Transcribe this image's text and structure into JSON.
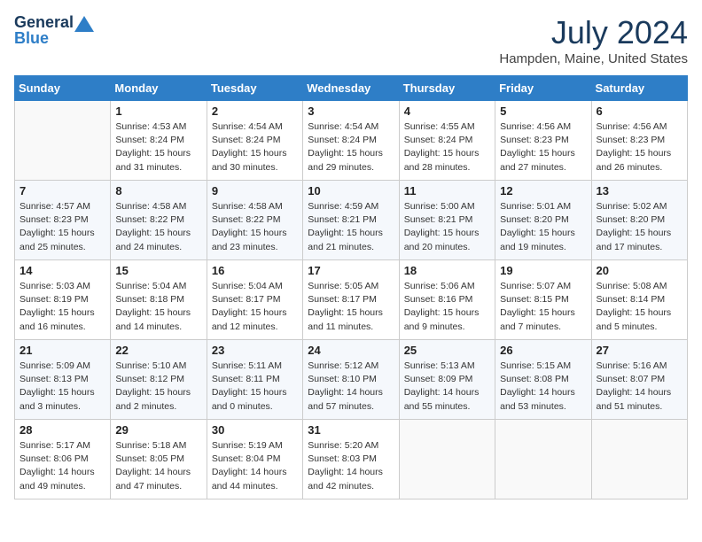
{
  "header": {
    "logo_line1": "General",
    "logo_line2": "Blue",
    "title": "July 2024",
    "subtitle": "Hampden, Maine, United States"
  },
  "weekdays": [
    "Sunday",
    "Monday",
    "Tuesday",
    "Wednesday",
    "Thursday",
    "Friday",
    "Saturday"
  ],
  "weeks": [
    [
      {
        "day": "",
        "info": ""
      },
      {
        "day": "1",
        "info": "Sunrise: 4:53 AM\nSunset: 8:24 PM\nDaylight: 15 hours\nand 31 minutes."
      },
      {
        "day": "2",
        "info": "Sunrise: 4:54 AM\nSunset: 8:24 PM\nDaylight: 15 hours\nand 30 minutes."
      },
      {
        "day": "3",
        "info": "Sunrise: 4:54 AM\nSunset: 8:24 PM\nDaylight: 15 hours\nand 29 minutes."
      },
      {
        "day": "4",
        "info": "Sunrise: 4:55 AM\nSunset: 8:24 PM\nDaylight: 15 hours\nand 28 minutes."
      },
      {
        "day": "5",
        "info": "Sunrise: 4:56 AM\nSunset: 8:23 PM\nDaylight: 15 hours\nand 27 minutes."
      },
      {
        "day": "6",
        "info": "Sunrise: 4:56 AM\nSunset: 8:23 PM\nDaylight: 15 hours\nand 26 minutes."
      }
    ],
    [
      {
        "day": "7",
        "info": "Sunrise: 4:57 AM\nSunset: 8:23 PM\nDaylight: 15 hours\nand 25 minutes."
      },
      {
        "day": "8",
        "info": "Sunrise: 4:58 AM\nSunset: 8:22 PM\nDaylight: 15 hours\nand 24 minutes."
      },
      {
        "day": "9",
        "info": "Sunrise: 4:58 AM\nSunset: 8:22 PM\nDaylight: 15 hours\nand 23 minutes."
      },
      {
        "day": "10",
        "info": "Sunrise: 4:59 AM\nSunset: 8:21 PM\nDaylight: 15 hours\nand 21 minutes."
      },
      {
        "day": "11",
        "info": "Sunrise: 5:00 AM\nSunset: 8:21 PM\nDaylight: 15 hours\nand 20 minutes."
      },
      {
        "day": "12",
        "info": "Sunrise: 5:01 AM\nSunset: 8:20 PM\nDaylight: 15 hours\nand 19 minutes."
      },
      {
        "day": "13",
        "info": "Sunrise: 5:02 AM\nSunset: 8:20 PM\nDaylight: 15 hours\nand 17 minutes."
      }
    ],
    [
      {
        "day": "14",
        "info": "Sunrise: 5:03 AM\nSunset: 8:19 PM\nDaylight: 15 hours\nand 16 minutes."
      },
      {
        "day": "15",
        "info": "Sunrise: 5:04 AM\nSunset: 8:18 PM\nDaylight: 15 hours\nand 14 minutes."
      },
      {
        "day": "16",
        "info": "Sunrise: 5:04 AM\nSunset: 8:17 PM\nDaylight: 15 hours\nand 12 minutes."
      },
      {
        "day": "17",
        "info": "Sunrise: 5:05 AM\nSunset: 8:17 PM\nDaylight: 15 hours\nand 11 minutes."
      },
      {
        "day": "18",
        "info": "Sunrise: 5:06 AM\nSunset: 8:16 PM\nDaylight: 15 hours\nand 9 minutes."
      },
      {
        "day": "19",
        "info": "Sunrise: 5:07 AM\nSunset: 8:15 PM\nDaylight: 15 hours\nand 7 minutes."
      },
      {
        "day": "20",
        "info": "Sunrise: 5:08 AM\nSunset: 8:14 PM\nDaylight: 15 hours\nand 5 minutes."
      }
    ],
    [
      {
        "day": "21",
        "info": "Sunrise: 5:09 AM\nSunset: 8:13 PM\nDaylight: 15 hours\nand 3 minutes."
      },
      {
        "day": "22",
        "info": "Sunrise: 5:10 AM\nSunset: 8:12 PM\nDaylight: 15 hours\nand 2 minutes."
      },
      {
        "day": "23",
        "info": "Sunrise: 5:11 AM\nSunset: 8:11 PM\nDaylight: 15 hours\nand 0 minutes."
      },
      {
        "day": "24",
        "info": "Sunrise: 5:12 AM\nSunset: 8:10 PM\nDaylight: 14 hours\nand 57 minutes."
      },
      {
        "day": "25",
        "info": "Sunrise: 5:13 AM\nSunset: 8:09 PM\nDaylight: 14 hours\nand 55 minutes."
      },
      {
        "day": "26",
        "info": "Sunrise: 5:15 AM\nSunset: 8:08 PM\nDaylight: 14 hours\nand 53 minutes."
      },
      {
        "day": "27",
        "info": "Sunrise: 5:16 AM\nSunset: 8:07 PM\nDaylight: 14 hours\nand 51 minutes."
      }
    ],
    [
      {
        "day": "28",
        "info": "Sunrise: 5:17 AM\nSunset: 8:06 PM\nDaylight: 14 hours\nand 49 minutes."
      },
      {
        "day": "29",
        "info": "Sunrise: 5:18 AM\nSunset: 8:05 PM\nDaylight: 14 hours\nand 47 minutes."
      },
      {
        "day": "30",
        "info": "Sunrise: 5:19 AM\nSunset: 8:04 PM\nDaylight: 14 hours\nand 44 minutes."
      },
      {
        "day": "31",
        "info": "Sunrise: 5:20 AM\nSunset: 8:03 PM\nDaylight: 14 hours\nand 42 minutes."
      },
      {
        "day": "",
        "info": ""
      },
      {
        "day": "",
        "info": ""
      },
      {
        "day": "",
        "info": ""
      }
    ]
  ]
}
